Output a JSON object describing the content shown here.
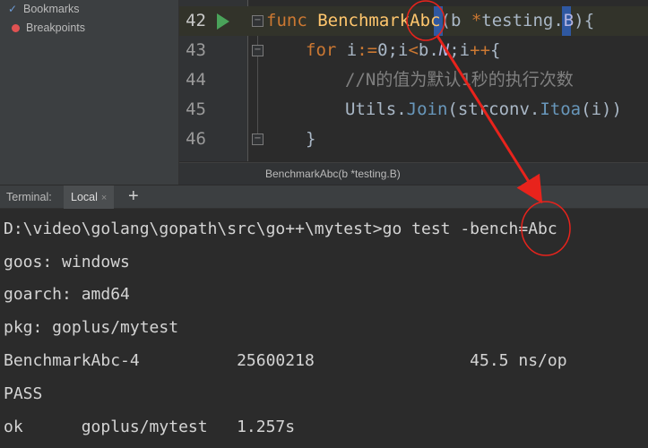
{
  "sidebar": {
    "items": [
      {
        "label": "Bookmarks"
      },
      {
        "label": "Breakpoints"
      }
    ]
  },
  "editor": {
    "lines": [
      {
        "no": "42",
        "code": "func BenchmarkAbc(b *testing.B){"
      },
      {
        "no": "43",
        "code": "for i:=0;i<b.N;i++{"
      },
      {
        "no": "44",
        "code": "//N的值为默认1秒的执行次数"
      },
      {
        "no": "45",
        "code": "Utils.Join(strconv.Itoa(i))"
      },
      {
        "no": "46",
        "code": "}"
      }
    ],
    "breadcrumb": "BenchmarkAbc(b *testing.B)"
  },
  "terminal": {
    "title": "Terminal:",
    "tab_label": "Local",
    "tab_close": "×",
    "add_label": "+",
    "lines": [
      "D:\\video\\golang\\gopath\\src\\go++\\mytest>go test -bench=Abc",
      "goos: windows",
      "goarch: amd64",
      "pkg: goplus/mytest",
      "BenchmarkAbc-4          25600218                45.5 ns/op",
      "PASS",
      "ok      goplus/mytest   1.257s"
    ]
  },
  "colors": {
    "keyword": "#cc7832",
    "function": "#ffc66d",
    "number": "#6897bb",
    "comment": "#808080",
    "annotation": "#e8231c",
    "run": "#4aa35a"
  },
  "icons": [
    "bookmark-check-icon",
    "breakpoint-dot-icon",
    "run-gutter-icon",
    "fold-icon",
    "close-icon",
    "add-icon"
  ]
}
